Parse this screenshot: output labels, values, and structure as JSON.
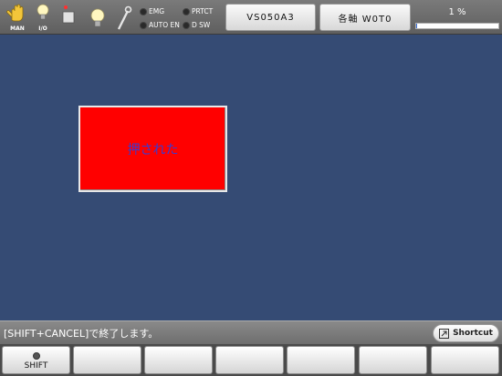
{
  "status_bar": {
    "mode_label": "MAN",
    "io_label": "I/O",
    "lamps": [
      {
        "label": "EMG"
      },
      {
        "label": "AUTO EN"
      },
      {
        "label": "PRTCT"
      },
      {
        "label": "D SW"
      }
    ],
    "robot_name": "VS050A3",
    "coord_label": "各軸 W0T0",
    "speed_text": "1 %",
    "speed_fraction": 0.01,
    "accent_color": "#3a6fd8"
  },
  "main": {
    "pressed_label": "押された",
    "pressed_color": "#ff0000"
  },
  "message_bar": {
    "message": "[SHIFT+CANCEL]で終了します。",
    "shortcut_label": "Shortcut"
  },
  "function_keys": [
    {
      "label": "SHIFT"
    },
    {
      "label": ""
    },
    {
      "label": ""
    },
    {
      "label": ""
    },
    {
      "label": ""
    },
    {
      "label": ""
    },
    {
      "label": ""
    }
  ]
}
